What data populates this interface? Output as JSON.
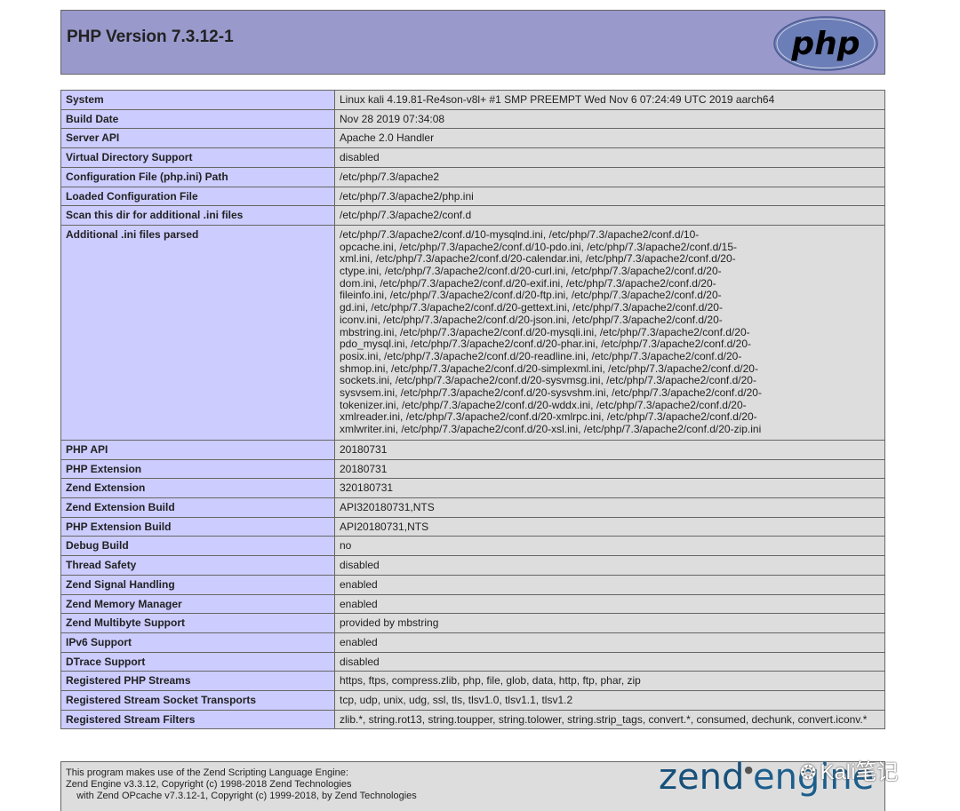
{
  "header": {
    "title": "PHP Version 7.3.12-1",
    "logo_text": "php"
  },
  "rows": [
    {
      "label": "System",
      "value": "Linux kali 4.19.81-Re4son-v8l+ #1 SMP PREEMPT Wed Nov 6 07:24:49 UTC 2019 aarch64"
    },
    {
      "label": "Build Date",
      "value": "Nov 28 2019 07:34:08"
    },
    {
      "label": "Server API",
      "value": "Apache 2.0 Handler"
    },
    {
      "label": "Virtual Directory Support",
      "value": "disabled"
    },
    {
      "label": "Configuration File (php.ini) Path",
      "value": "/etc/php/7.3/apache2"
    },
    {
      "label": "Loaded Configuration File",
      "value": "/etc/php/7.3/apache2/php.ini"
    },
    {
      "label": "Scan this dir for additional .ini files",
      "value": "/etc/php/7.3/apache2/conf.d"
    },
    {
      "label": "Additional .ini files parsed",
      "value": "/etc/php/7.3/apache2/conf.d/10-mysqlnd.ini, /etc/php/7.3/apache2/conf.d/10-\nopcache.ini, /etc/php/7.3/apache2/conf.d/10-pdo.ini, /etc/php/7.3/apache2/conf.d/15-\nxml.ini, /etc/php/7.3/apache2/conf.d/20-calendar.ini, /etc/php/7.3/apache2/conf.d/20-\nctype.ini, /etc/php/7.3/apache2/conf.d/20-curl.ini, /etc/php/7.3/apache2/conf.d/20-\ndom.ini, /etc/php/7.3/apache2/conf.d/20-exif.ini, /etc/php/7.3/apache2/conf.d/20-\nfileinfo.ini, /etc/php/7.3/apache2/conf.d/20-ftp.ini, /etc/php/7.3/apache2/conf.d/20-\ngd.ini, /etc/php/7.3/apache2/conf.d/20-gettext.ini, /etc/php/7.3/apache2/conf.d/20-\niconv.ini, /etc/php/7.3/apache2/conf.d/20-json.ini, /etc/php/7.3/apache2/conf.d/20-\nmbstring.ini, /etc/php/7.3/apache2/conf.d/20-mysqli.ini, /etc/php/7.3/apache2/conf.d/20-\npdo_mysql.ini, /etc/php/7.3/apache2/conf.d/20-phar.ini, /etc/php/7.3/apache2/conf.d/20-\nposix.ini, /etc/php/7.3/apache2/conf.d/20-readline.ini, /etc/php/7.3/apache2/conf.d/20-\nshmop.ini, /etc/php/7.3/apache2/conf.d/20-simplexml.ini, /etc/php/7.3/apache2/conf.d/20-\nsockets.ini, /etc/php/7.3/apache2/conf.d/20-sysvmsg.ini, /etc/php/7.3/apache2/conf.d/20-\nsysvsem.ini, /etc/php/7.3/apache2/conf.d/20-sysvshm.ini, /etc/php/7.3/apache2/conf.d/20-\ntokenizer.ini, /etc/php/7.3/apache2/conf.d/20-wddx.ini, /etc/php/7.3/apache2/conf.d/20-\nxmlreader.ini, /etc/php/7.3/apache2/conf.d/20-xmlrpc.ini, /etc/php/7.3/apache2/conf.d/20-\nxmlwriter.ini, /etc/php/7.3/apache2/conf.d/20-xsl.ini, /etc/php/7.3/apache2/conf.d/20-zip.ini"
    },
    {
      "label": "PHP API",
      "value": "20180731"
    },
    {
      "label": "PHP Extension",
      "value": "20180731"
    },
    {
      "label": "Zend Extension",
      "value": "320180731"
    },
    {
      "label": "Zend Extension Build",
      "value": "API320180731,NTS"
    },
    {
      "label": "PHP Extension Build",
      "value": "API20180731,NTS"
    },
    {
      "label": "Debug Build",
      "value": "no"
    },
    {
      "label": "Thread Safety",
      "value": "disabled"
    },
    {
      "label": "Zend Signal Handling",
      "value": "enabled"
    },
    {
      "label": "Zend Memory Manager",
      "value": "enabled"
    },
    {
      "label": "Zend Multibyte Support",
      "value": "provided by mbstring"
    },
    {
      "label": "IPv6 Support",
      "value": "enabled"
    },
    {
      "label": "DTrace Support",
      "value": "disabled"
    },
    {
      "label": "Registered PHP Streams",
      "value": "https, ftps, compress.zlib, php, file, glob, data, http, ftp, phar, zip"
    },
    {
      "label": "Registered Stream Socket Transports",
      "value": "tcp, udp, unix, udg, ssl, tls, tlsv1.0, tlsv1.1, tlsv1.2"
    },
    {
      "label": "Registered Stream Filters",
      "value": "zlib.*, string.rot13, string.toupper, string.tolower, string.strip_tags, convert.*, consumed, dechunk, convert.iconv.*"
    }
  ],
  "footer": {
    "line1": "This program makes use of the Zend Scripting Language Engine:",
    "line2": "Zend Engine v3.3.12, Copyright (c) 1998-2018 Zend Technologies",
    "line3": "    with Zend OPcache v7.3.12-1, Copyright (c) 1999-2018, by Zend Technologies",
    "zend_logo_text_1": "zend",
    "zend_logo_text_2": "engine"
  },
  "watermark": {
    "text": "Kali笔记",
    "icon": "wechat-icon"
  },
  "colors": {
    "header_bg": "#9999cc",
    "label_bg": "#ccccff",
    "value_bg": "#dddddd",
    "border": "#666666",
    "php_logo": "#6c7eb7"
  }
}
